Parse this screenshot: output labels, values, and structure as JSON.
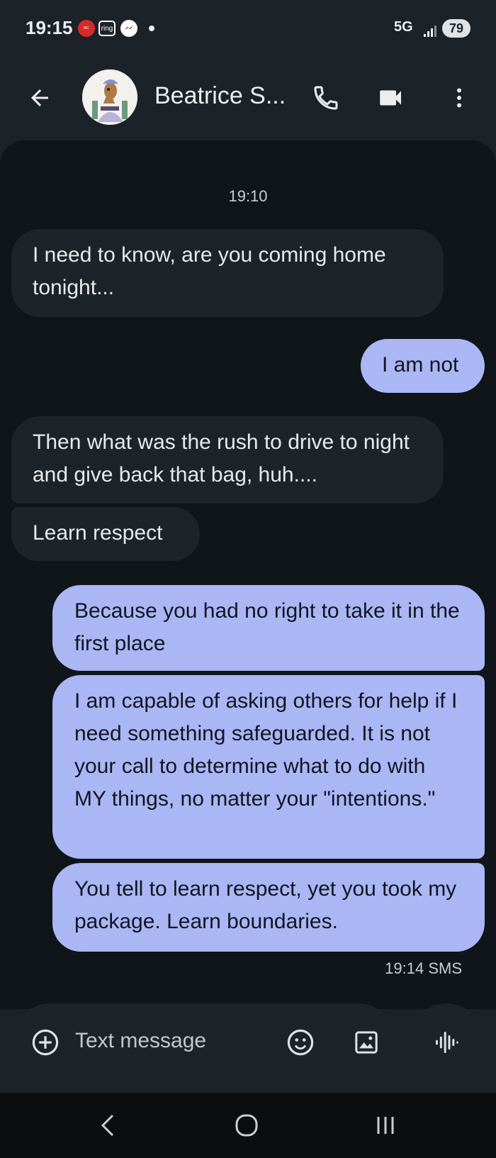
{
  "status_bar": {
    "time": "19:15",
    "notification_icons": [
      "mcdonalds-app-icon",
      "ring-icon",
      "messenger-icon",
      "more-notifications-dot"
    ],
    "ring_label": "ring",
    "network": "5G",
    "battery": "79"
  },
  "app_bar": {
    "contact_name": "Beatrice S...",
    "icons": [
      "back-arrow-icon",
      "avatar",
      "phone-icon",
      "video-call-icon",
      "more-vert-icon"
    ]
  },
  "conversation": {
    "timestamp": "19:10",
    "messages": [
      {
        "direction": "incoming",
        "text": "I need to know, are you coming home tonight..."
      },
      {
        "direction": "outgoing",
        "text": "I am not"
      },
      {
        "direction": "incoming",
        "text": "Then what was the rush to drive to night and give back that bag, huh...."
      },
      {
        "direction": "incoming",
        "text": "Learn respect"
      },
      {
        "direction": "outgoing",
        "text": "Because you had no right to take it in the first place"
      },
      {
        "direction": "outgoing",
        "text": "I am capable of asking others for help if I need something safeguarded. It is not your call to determine what to do with MY things, no matter your \"intentions.\""
      },
      {
        "direction": "outgoing",
        "text": "You tell to learn respect, yet you took my package. Learn boundaries."
      }
    ],
    "last_meta": "19:14  SMS"
  },
  "composer": {
    "placeholder": "Text message",
    "icons": [
      "add-icon",
      "emoji-icon",
      "image-icon",
      "voice-icon"
    ]
  },
  "nav_bar": {
    "icons": [
      "nav-back-icon",
      "nav-home-icon",
      "nav-recents-icon"
    ]
  },
  "colors": {
    "background": "#1b2228",
    "chat_background": "#0f1518",
    "incoming_bubble": "#1d2429",
    "outgoing_bubble": "#aab7f4",
    "nav_background": "#0b0e10"
  }
}
